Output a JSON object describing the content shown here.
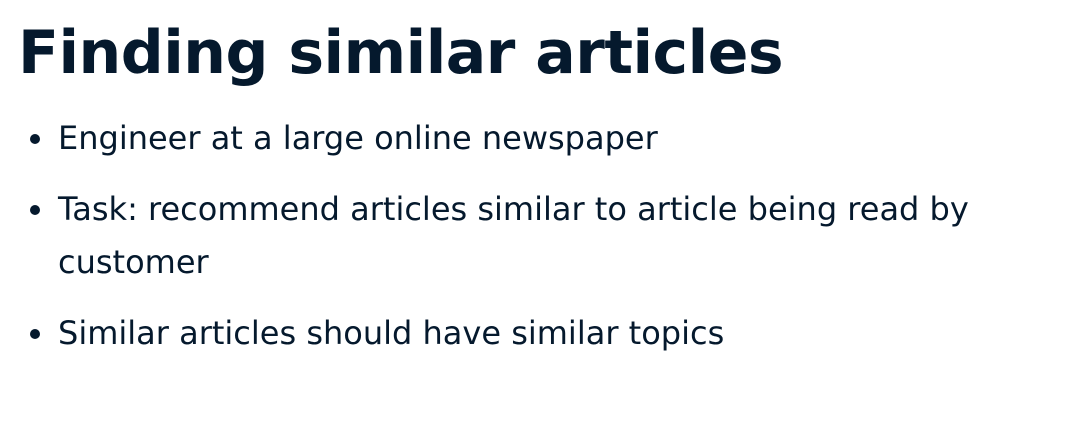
{
  "slide": {
    "title": "Finding similar articles",
    "bullets": [
      "Engineer at a large online newspaper",
      "Task: recommend articles similar to article being read by customer",
      "Similar articles should have similar topics"
    ]
  }
}
